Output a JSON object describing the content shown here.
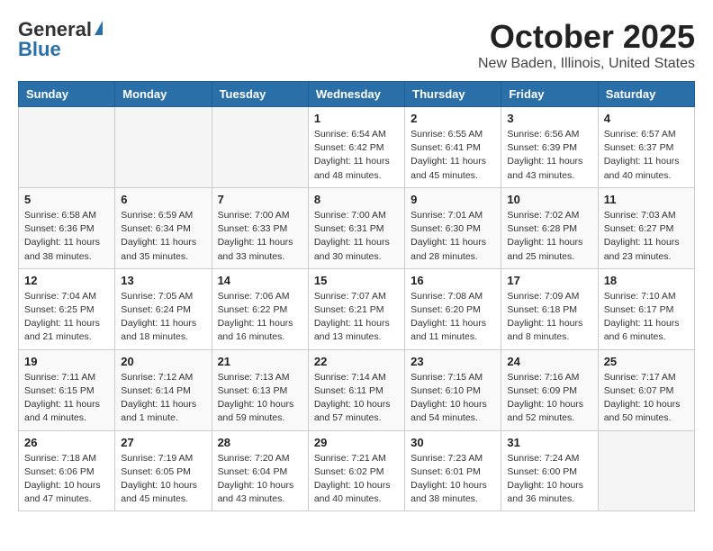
{
  "header": {
    "logo_general": "General",
    "logo_blue": "Blue",
    "month_title": "October 2025",
    "location": "New Baden, Illinois, United States"
  },
  "weekdays": [
    "Sunday",
    "Monday",
    "Tuesday",
    "Wednesday",
    "Thursday",
    "Friday",
    "Saturday"
  ],
  "weeks": [
    [
      {
        "day": "",
        "info": ""
      },
      {
        "day": "",
        "info": ""
      },
      {
        "day": "",
        "info": ""
      },
      {
        "day": "1",
        "info": "Sunrise: 6:54 AM\nSunset: 6:42 PM\nDaylight: 11 hours\nand 48 minutes."
      },
      {
        "day": "2",
        "info": "Sunrise: 6:55 AM\nSunset: 6:41 PM\nDaylight: 11 hours\nand 45 minutes."
      },
      {
        "day": "3",
        "info": "Sunrise: 6:56 AM\nSunset: 6:39 PM\nDaylight: 11 hours\nand 43 minutes."
      },
      {
        "day": "4",
        "info": "Sunrise: 6:57 AM\nSunset: 6:37 PM\nDaylight: 11 hours\nand 40 minutes."
      }
    ],
    [
      {
        "day": "5",
        "info": "Sunrise: 6:58 AM\nSunset: 6:36 PM\nDaylight: 11 hours\nand 38 minutes."
      },
      {
        "day": "6",
        "info": "Sunrise: 6:59 AM\nSunset: 6:34 PM\nDaylight: 11 hours\nand 35 minutes."
      },
      {
        "day": "7",
        "info": "Sunrise: 7:00 AM\nSunset: 6:33 PM\nDaylight: 11 hours\nand 33 minutes."
      },
      {
        "day": "8",
        "info": "Sunrise: 7:00 AM\nSunset: 6:31 PM\nDaylight: 11 hours\nand 30 minutes."
      },
      {
        "day": "9",
        "info": "Sunrise: 7:01 AM\nSunset: 6:30 PM\nDaylight: 11 hours\nand 28 minutes."
      },
      {
        "day": "10",
        "info": "Sunrise: 7:02 AM\nSunset: 6:28 PM\nDaylight: 11 hours\nand 25 minutes."
      },
      {
        "day": "11",
        "info": "Sunrise: 7:03 AM\nSunset: 6:27 PM\nDaylight: 11 hours\nand 23 minutes."
      }
    ],
    [
      {
        "day": "12",
        "info": "Sunrise: 7:04 AM\nSunset: 6:25 PM\nDaylight: 11 hours\nand 21 minutes."
      },
      {
        "day": "13",
        "info": "Sunrise: 7:05 AM\nSunset: 6:24 PM\nDaylight: 11 hours\nand 18 minutes."
      },
      {
        "day": "14",
        "info": "Sunrise: 7:06 AM\nSunset: 6:22 PM\nDaylight: 11 hours\nand 16 minutes."
      },
      {
        "day": "15",
        "info": "Sunrise: 7:07 AM\nSunset: 6:21 PM\nDaylight: 11 hours\nand 13 minutes."
      },
      {
        "day": "16",
        "info": "Sunrise: 7:08 AM\nSunset: 6:20 PM\nDaylight: 11 hours\nand 11 minutes."
      },
      {
        "day": "17",
        "info": "Sunrise: 7:09 AM\nSunset: 6:18 PM\nDaylight: 11 hours\nand 8 minutes."
      },
      {
        "day": "18",
        "info": "Sunrise: 7:10 AM\nSunset: 6:17 PM\nDaylight: 11 hours\nand 6 minutes."
      }
    ],
    [
      {
        "day": "19",
        "info": "Sunrise: 7:11 AM\nSunset: 6:15 PM\nDaylight: 11 hours\nand 4 minutes."
      },
      {
        "day": "20",
        "info": "Sunrise: 7:12 AM\nSunset: 6:14 PM\nDaylight: 11 hours\nand 1 minute."
      },
      {
        "day": "21",
        "info": "Sunrise: 7:13 AM\nSunset: 6:13 PM\nDaylight: 10 hours\nand 59 minutes."
      },
      {
        "day": "22",
        "info": "Sunrise: 7:14 AM\nSunset: 6:11 PM\nDaylight: 10 hours\nand 57 minutes."
      },
      {
        "day": "23",
        "info": "Sunrise: 7:15 AM\nSunset: 6:10 PM\nDaylight: 10 hours\nand 54 minutes."
      },
      {
        "day": "24",
        "info": "Sunrise: 7:16 AM\nSunset: 6:09 PM\nDaylight: 10 hours\nand 52 minutes."
      },
      {
        "day": "25",
        "info": "Sunrise: 7:17 AM\nSunset: 6:07 PM\nDaylight: 10 hours\nand 50 minutes."
      }
    ],
    [
      {
        "day": "26",
        "info": "Sunrise: 7:18 AM\nSunset: 6:06 PM\nDaylight: 10 hours\nand 47 minutes."
      },
      {
        "day": "27",
        "info": "Sunrise: 7:19 AM\nSunset: 6:05 PM\nDaylight: 10 hours\nand 45 minutes."
      },
      {
        "day": "28",
        "info": "Sunrise: 7:20 AM\nSunset: 6:04 PM\nDaylight: 10 hours\nand 43 minutes."
      },
      {
        "day": "29",
        "info": "Sunrise: 7:21 AM\nSunset: 6:02 PM\nDaylight: 10 hours\nand 40 minutes."
      },
      {
        "day": "30",
        "info": "Sunrise: 7:23 AM\nSunset: 6:01 PM\nDaylight: 10 hours\nand 38 minutes."
      },
      {
        "day": "31",
        "info": "Sunrise: 7:24 AM\nSunset: 6:00 PM\nDaylight: 10 hours\nand 36 minutes."
      },
      {
        "day": "",
        "info": ""
      }
    ]
  ]
}
